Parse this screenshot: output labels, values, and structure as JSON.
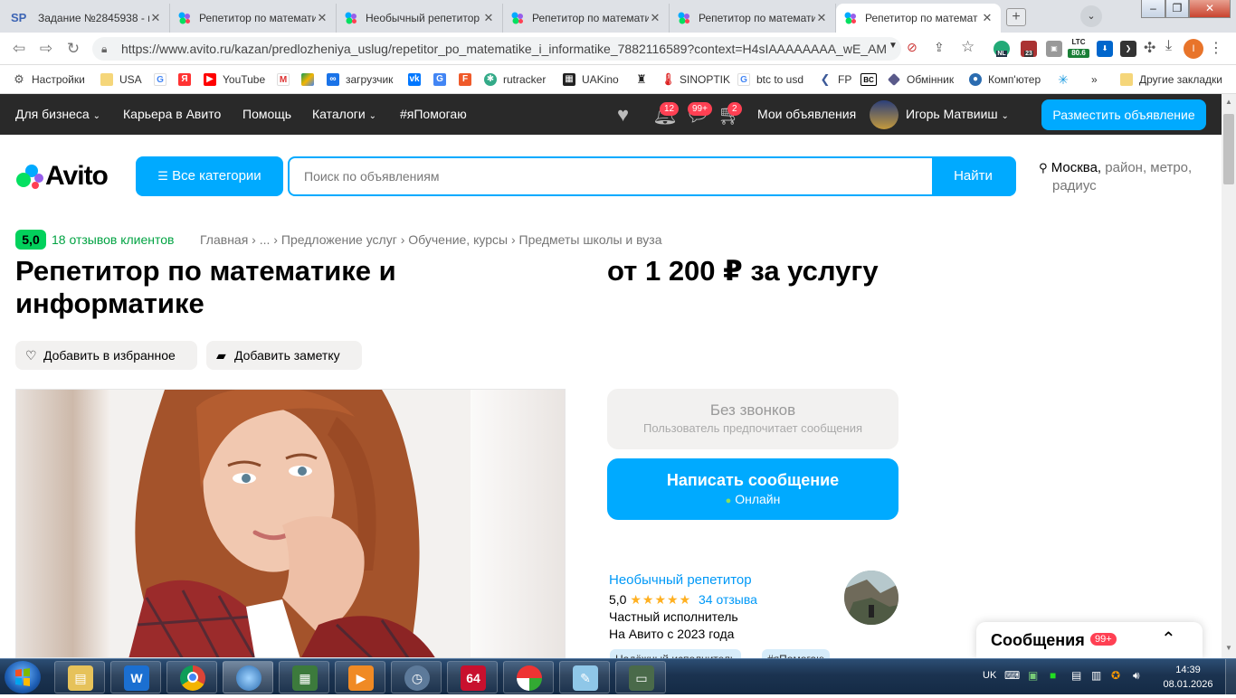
{
  "tabs": [
    {
      "label": "Задание №2845938 - п",
      "active": false
    },
    {
      "label": "Репетитор по математи",
      "active": false
    },
    {
      "label": "Необычный репетитор",
      "active": false
    },
    {
      "label": "Репетитор по математи",
      "active": false
    },
    {
      "label": "Репетитор по математи",
      "active": false
    },
    {
      "label": "Репетитор по математ",
      "active": true
    }
  ],
  "tab_sp_icon": "SP",
  "address": {
    "url": "https://www.avito.ru/kazan/predlozheniya_uslug/repetitor_po_matematike_i_informatike_7882116589?context=H4sIAAAAAAAA_wE_AM"
  },
  "extensions": {
    "nl": "NL",
    "count": "23",
    "ltc_label": "LTC",
    "ltc_value": "80.6",
    "profile_letter": "I"
  },
  "bookmarks": [
    "Настройки",
    "USA",
    "",
    "",
    "YouTube",
    "",
    "",
    "загрузчик",
    "",
    "",
    "",
    "rutracker",
    "UAKino",
    "",
    "SINOPTIK",
    "btc to usd",
    "FP",
    "",
    "Обмінник",
    "Комп'ютер",
    "",
    "»",
    "Другие закладки"
  ],
  "topnav": {
    "business": "Для бизнеса",
    "career": "Карьера в Авито",
    "help": "Помощь",
    "catalogs": "Каталоги",
    "ihelp": "#яПомогаю",
    "badge_notify": "12",
    "badge_msgs": "99+",
    "badge_cart": "2",
    "my_ads": "Мои объявления",
    "user": "Игорь Матвииш",
    "post_button": "Разместить объявление"
  },
  "logo_text": "Avito",
  "search": {
    "categories_button": "Все категории",
    "placeholder": "Поиск по объявлениям",
    "find_button": "Найти"
  },
  "location": {
    "city": "Москва,",
    "rest": " район, метро,",
    "line2": "радиус"
  },
  "rating": {
    "score": "5,0",
    "reviews": "18 отзывов клиентов"
  },
  "breadcrumbs": [
    "Главная",
    "...",
    "Предложение услуг",
    "Обучение, курсы",
    "Предметы школы и вуза"
  ],
  "listing": {
    "title": "Репетитор по математике и информатике",
    "price": "от 1 200 ₽ за услугу"
  },
  "actions": {
    "favorite": "Добавить в избранное",
    "note": "Добавить заметку"
  },
  "contact": {
    "no_calls_title": "Без звонков",
    "no_calls_sub": "Пользователь предпочитает сообщения",
    "write_button": "Написать сообщение",
    "online": "Онлайн"
  },
  "seller": {
    "name": "Необычный репетитор",
    "score": "5,0",
    "stars": "★★★★★",
    "reviews": "34 отзыва",
    "type": "Частный исполнитель",
    "since": "На Авито с 2023 года",
    "tags": [
      "Надёжный исполнитель",
      "#яПомогаю"
    ]
  },
  "messages_widget": {
    "label": "Сообщения",
    "badge": "99+"
  },
  "taskbar": {
    "lang": "UK",
    "time": "14:39",
    "date": "08.01.2026",
    "app64": "64"
  },
  "colors": {
    "accent": "#00aaff",
    "rating_green": "#02d15c",
    "nav_dark": "#292929",
    "badge_red": "#ff4053",
    "link_green": "#02a343",
    "link_blue": "#0099f7"
  }
}
